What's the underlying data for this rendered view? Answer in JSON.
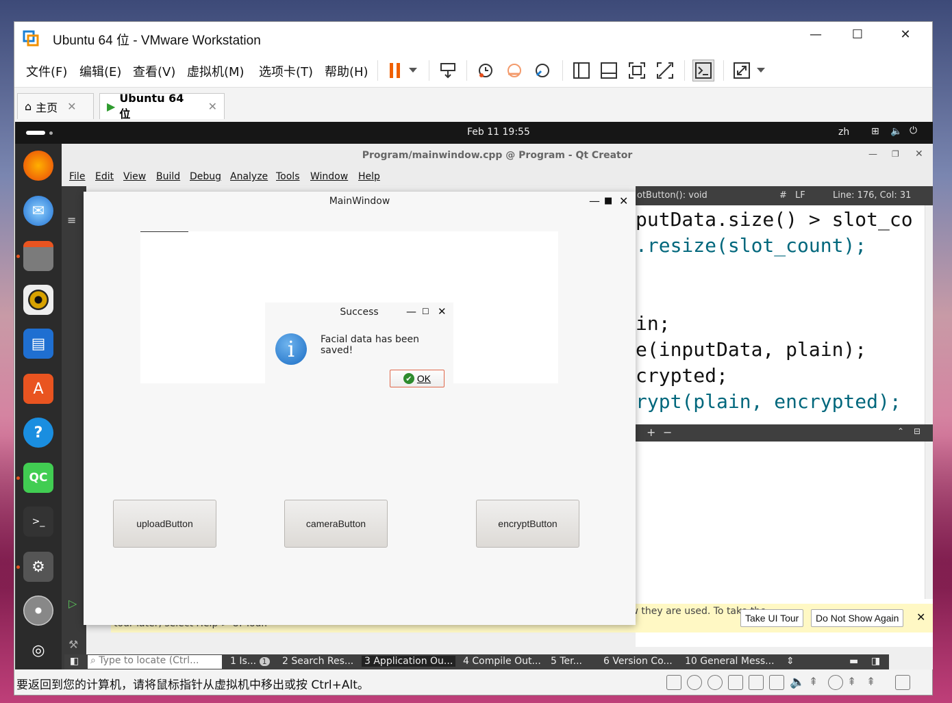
{
  "vmware": {
    "title": "Ubuntu 64 位 - VMware Workstation",
    "menu": [
      "文件(F)",
      "编辑(E)",
      "查看(V)",
      "虚拟机(M)",
      "选项卡(T)",
      "帮助(H)"
    ],
    "tabs": [
      {
        "label": "主页",
        "close": "✕"
      },
      {
        "label": "Ubuntu 64 位",
        "close": "✕"
      }
    ],
    "status_text": "要返回到您的计算机，请将鼠标指针从虚拟机中移出或按 Ctrl+Alt。"
  },
  "ubuntu": {
    "clock": "Feb 11  19:55",
    "lang": "zh"
  },
  "qtcreator": {
    "title": "Program/mainwindow.cpp @ Program - Qt Creator",
    "menu": [
      "File",
      "Edit",
      "View",
      "Build",
      "Debug",
      "Analyze",
      "Tools",
      "Window",
      "Help"
    ],
    "editor_header": {
      "function": "otButton(): void",
      "hash": "#",
      "line_ending": "LF",
      "position": "Line: 176, Col: 31"
    },
    "code_lines": [
      "putData.size() > slot_co",
      ".resize(slot_count);",
      "",
      "",
      "in;",
      "e(inputData, plain);",
      "crypted;",
      "rypt(plain, encrypted);"
    ],
    "tour": {
      "message_line1": "Would you like to take a quick UI tour? This tour highlights important user interface elements and shows how they are used. To take the",
      "message_line2": "tour later, select Help > UI Tour.",
      "take_tour": "Take UI Tour",
      "do_not_show": "Do Not Show Again"
    },
    "statusbar": {
      "locate_placeholder": "Type to locate (Ctrl...",
      "tabs": [
        "1 Is...",
        "2 Search Res...",
        "3 Application Ou...",
        "4 Compile Out...",
        "5 Ter...",
        "6 Version Co...",
        "10 General Mess..."
      ],
      "issues_count": "1"
    }
  },
  "mainwindow": {
    "title": "MainWindow",
    "buttons": {
      "upload": "uploadButton",
      "camera": "cameraButton",
      "encrypt": "encryptButton"
    }
  },
  "dialog": {
    "title": "Success",
    "message": "Facial data has been saved!",
    "ok_label": "OK",
    "icon": "info-icon"
  },
  "colors": {
    "ubuntu_orange": "#e95420",
    "dialog_ok_border": "#e0674a",
    "keyword": "#00677c"
  }
}
